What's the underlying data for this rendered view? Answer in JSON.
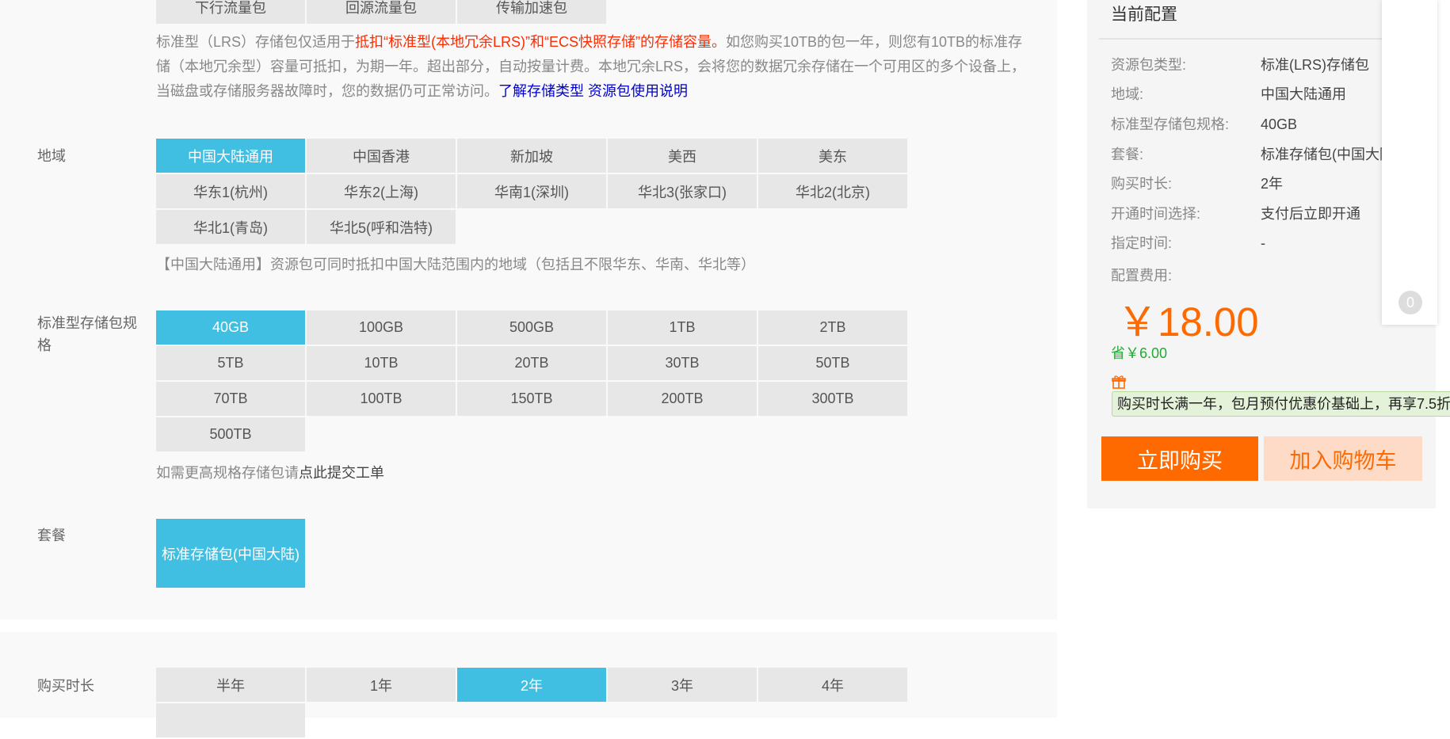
{
  "type_grid": {
    "options": [
      "下行流量包",
      "回源流量包",
      "传输加速包"
    ]
  },
  "type_note": {
    "part1": "标准型（LRS）存储包仅适用于",
    "part2_red": "抵扣“标准型(本地冗余LRS)”和“ECS快照存储”的存储容量。",
    "part3": "如您购买10TB的包一年，则您有10TB的标准存储（本地冗余型）容量可抵扣，为期一年。超出部分，自动按量计费。本地冗余LRS，会将您的数据冗余存储在一个可用区的多个设备上，当磁盘或存储服务器故障时，您的数据仍可正常访问。",
    "link1": "了解存储类型",
    "link2": "资源包使用说明"
  },
  "region": {
    "label": "地域",
    "rows": [
      [
        "中国大陆通用",
        "中国香港",
        "新加坡",
        "美西",
        "美东"
      ],
      [
        "华东1(杭州)",
        "华东2(上海)",
        "华南1(深圳)",
        "华北3(张家口)",
        "华北2(北京)"
      ],
      [
        "华北1(青岛)",
        "华北5(呼和浩特)"
      ]
    ],
    "selected": "中国大陆通用",
    "note": "【中国大陆通用】资源包可同时抵扣中国大陆范围内的地域（包括且不限华东、华南、华北等）"
  },
  "spec": {
    "label_line1": "标准型存储包规",
    "label_line2": "格",
    "rows": [
      [
        "40GB",
        "100GB",
        "500GB",
        "1TB",
        "2TB"
      ],
      [
        "5TB",
        "10TB",
        "20TB",
        "30TB",
        "50TB"
      ],
      [
        "70TB",
        "100TB",
        "150TB",
        "200TB",
        "300TB"
      ],
      [
        "500TB"
      ]
    ],
    "selected": "40GB",
    "note_prefix": "如需更高规格存储包请",
    "note_link": "点此提交工单"
  },
  "package": {
    "label": "套餐",
    "option": "标准存储包(中国大陆)"
  },
  "duration": {
    "label": "购买时长",
    "options": [
      "半年",
      "1年",
      "2年",
      "3年",
      "4年"
    ],
    "selected": "2年"
  },
  "sidebar": {
    "title": "当前配置",
    "items": [
      {
        "k": "资源包类型:",
        "v": "标准(LRS)存储包"
      },
      {
        "k": "地域:",
        "v": "中国大陆通用"
      },
      {
        "k": "标准型存储包规格:",
        "v": "40GB"
      },
      {
        "k": "套餐:",
        "v": "标准存储包(中国大陆)"
      },
      {
        "k": "购买时长:",
        "v": "2年"
      },
      {
        "k": "开通时间选择:",
        "v": "支付后立即开通"
      },
      {
        "k": "指定时间:",
        "v": "-"
      }
    ],
    "fee_label": "配置费用:",
    "price": "￥18.00",
    "saving": "省￥6.00",
    "promo": "购买时长满一年，包月预付优惠价基础上，再享7.5折",
    "buy": "立即购买",
    "cart": "加入购物车"
  },
  "float_badge": "0",
  "colors": {
    "selected": "#41bfe3",
    "accent": "#ff6a00",
    "option_bg": "#e7e7e7"
  }
}
